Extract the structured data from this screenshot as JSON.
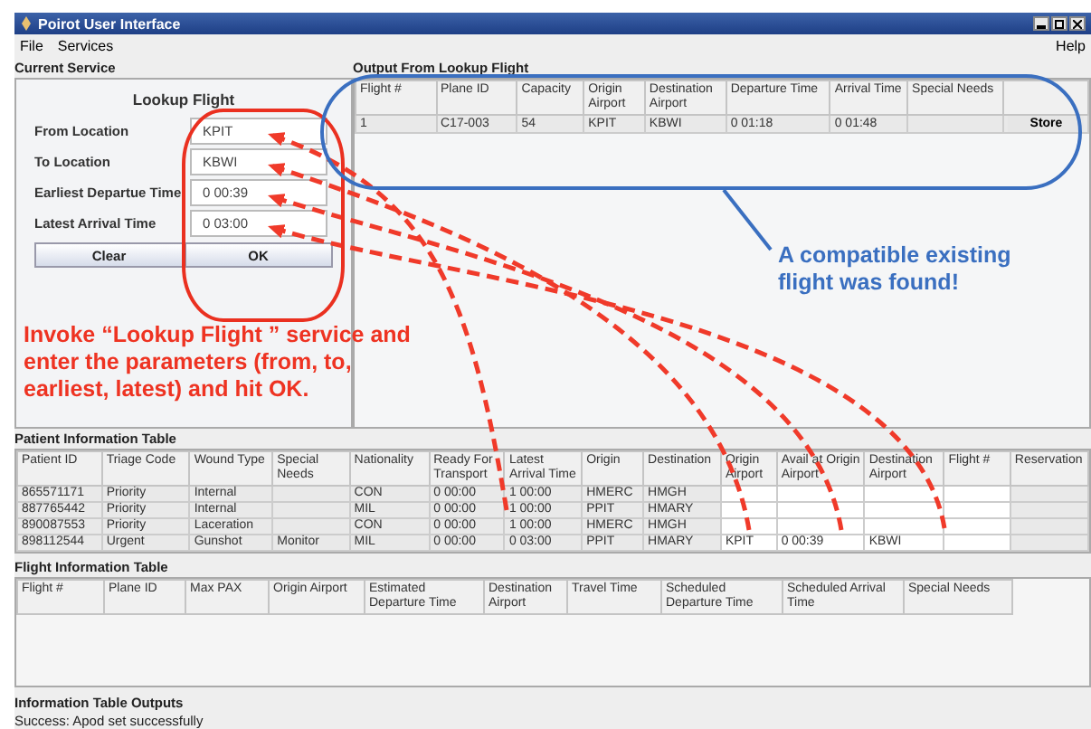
{
  "window": {
    "title": "Poirot User Interface"
  },
  "menu": [
    {
      "label": "File"
    },
    {
      "label": "Services"
    }
  ],
  "help_menu": "Help",
  "current_service": {
    "heading": "Current Service",
    "form_title": "Lookup Flight",
    "fields": [
      {
        "label": "From Location",
        "value": "KPIT"
      },
      {
        "label": "To Location",
        "value": "KBWI"
      },
      {
        "label": "Earliest Departue Time",
        "value": "0 00:39"
      },
      {
        "label": "Latest Arrival Time",
        "value": "0 03:00"
      }
    ],
    "buttons": [
      "Clear",
      "OK"
    ]
  },
  "output": {
    "heading": "Output From Lookup Flight",
    "columns": [
      "Flight #",
      "Plane ID",
      "Capacity",
      "Origin Airport",
      "Destination Airport",
      "Departure Time",
      "Arrival Time",
      "Special Needs",
      null
    ],
    "rows": [
      {
        "cells": [
          "1",
          "C17-003",
          "54",
          "KPIT",
          "KBWI",
          "0 01:18",
          "0 01:48",
          null
        ],
        "action": "Store"
      }
    ]
  },
  "annotations": [
    {
      "kind": "instruction",
      "text": "Invoke “Lookup Flight ” service and enter the parameters (from, to, earliest, latest) and hit OK.",
      "color": "#ee3322"
    },
    {
      "kind": "result",
      "text": "A compatible existing flight was found!",
      "color": "#3a6fc0"
    }
  ],
  "patient_table": {
    "heading": "Patient Information Table",
    "columns": [
      "Patient ID",
      "Triage Code",
      "Wound Type",
      "Special Needs",
      "Nationality",
      "Ready For Transport",
      "Latest Arrival Time",
      "Origin",
      "Destination",
      "Origin Airport",
      "Avail at Origin Airport",
      "Destination Airport",
      "Flight #",
      "Reservation"
    ],
    "rows": [
      {
        "cells": [
          "865571171",
          "Priority",
          "Internal",
          null,
          "CON",
          "0 00:00",
          "1 00:00",
          "HMERC",
          "HMGH",
          null,
          null,
          null,
          null,
          null
        ]
      },
      {
        "cells": [
          "887765442",
          "Priority",
          "Internal",
          null,
          "MIL",
          "0 00:00",
          "1 00:00",
          "PPIT",
          "HMARY",
          null,
          null,
          null,
          null,
          null
        ]
      },
      {
        "cells": [
          "890087553",
          "Priority",
          "Laceration",
          null,
          "CON",
          "0 00:00",
          "1 00:00",
          "HMERC",
          "HMGH",
          null,
          null,
          null,
          null,
          null
        ]
      },
      {
        "cells": [
          "898112544",
          "Urgent",
          "Gunshot",
          "Monitor",
          "MIL",
          "0 00:00",
          "0 03:00",
          "PPIT",
          "HMARY",
          "KPIT",
          "0 00:39",
          "KBWI",
          null,
          null
        ]
      }
    ]
  },
  "flight_table": {
    "heading": "Flight Information Table",
    "columns": [
      "Flight #",
      "Plane ID",
      "Max PAX",
      "Origin Airport",
      "Estimated Departure Time",
      "Destination Airport",
      "Travel Time",
      "Scheduled Departure Time",
      "Scheduled Arrival Time",
      "Special Needs"
    ]
  },
  "info": {
    "heading": "Information Table Outputs",
    "message": "Success: Apod set successfully"
  }
}
